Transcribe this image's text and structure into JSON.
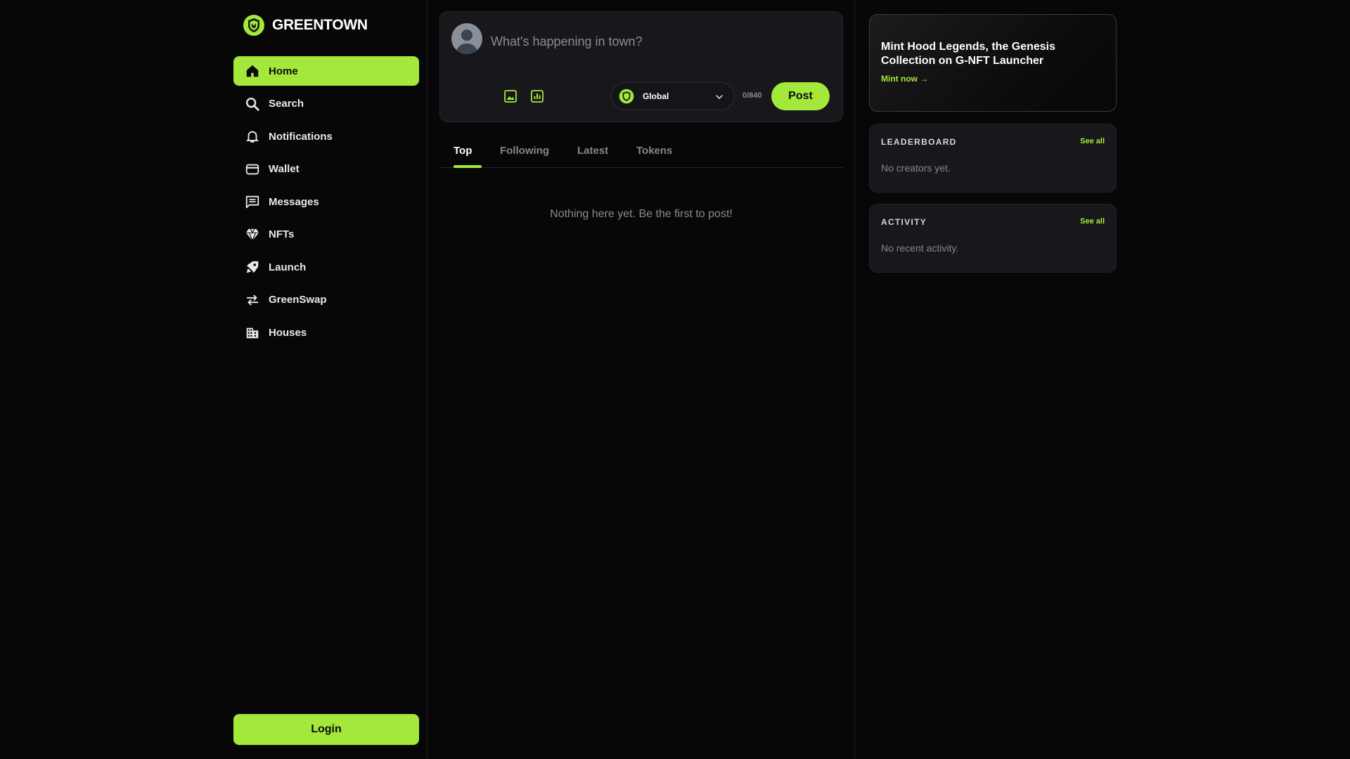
{
  "brand": {
    "name": "GREENTOWN",
    "accent": "#a4e83b"
  },
  "nav": {
    "items": [
      {
        "label": "Home",
        "icon": "home-icon",
        "active": true
      },
      {
        "label": "Search",
        "icon": "search-icon"
      },
      {
        "label": "Notifications",
        "icon": "bell-icon"
      },
      {
        "label": "Wallet",
        "icon": "wallet-icon"
      },
      {
        "label": "Messages",
        "icon": "message-icon"
      },
      {
        "label": "NFTs",
        "icon": "diamond-icon"
      },
      {
        "label": "Launch",
        "icon": "rocket-icon"
      },
      {
        "label": "GreenSwap",
        "icon": "swap-arrows-icon"
      },
      {
        "label": "Houses",
        "icon": "building-icon"
      }
    ],
    "login_label": "Login"
  },
  "composer": {
    "placeholder": "What's happening in town?",
    "scope": "Global",
    "counter": "0/840",
    "post_label": "Post"
  },
  "feed": {
    "tabs": [
      "Top",
      "Following",
      "Latest",
      "Tokens"
    ],
    "active_tab": "Top",
    "empty_text": "Nothing here yet. Be the first to post!"
  },
  "promo": {
    "title": "Mint Hood Legends, the Genesis Collection on G-NFT Launcher",
    "link": "Mint now →"
  },
  "leaderboard": {
    "title": "LEADERBOARD",
    "see_all": "See all",
    "empty": "No creators yet."
  },
  "activity": {
    "title": "ACTIVITY",
    "see_all": "See all",
    "empty": "No recent activity."
  }
}
